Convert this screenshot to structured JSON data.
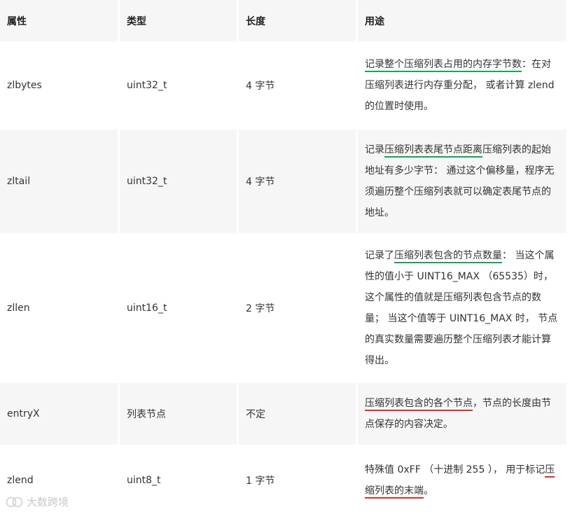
{
  "headers": [
    "属性",
    "类型",
    "长度",
    "用途"
  ],
  "rows": [
    {
      "attr": "zlbytes",
      "type": "uint32_t",
      "len": "4 字节",
      "desc": [
        {
          "t": "记录整个压缩列表占用的内存字节数",
          "u": "g"
        },
        {
          "t": "：在对压缩列表进行内存重分配， 或者计算 zlend 的位置时使用。"
        }
      ]
    },
    {
      "attr": "zltail",
      "type": "uint32_t",
      "len": "4 字节",
      "desc": [
        {
          "t": "记录"
        },
        {
          "t": "压缩列表表尾节点距离",
          "u": "g"
        },
        {
          "t": "压缩列表的起始地址有多少字节： 通过这个偏移量，程序无须遍历整个压缩列表就可以确定表尾节点的地址。"
        }
      ]
    },
    {
      "attr": "zllen",
      "type": "uint16_t",
      "len": "2 字节",
      "desc": [
        {
          "t": "记录了"
        },
        {
          "t": "压缩列表包含的节点数量",
          "u": "g"
        },
        {
          "t": "： 当这个属性的值小于 UINT16_MAX （65535）时， 这个属性的值就是压缩列表包含节点的数量； 当这个值等于 UINT16_MAX 时， 节点的真实数量需要遍历整个压缩列表才能计算得出。"
        }
      ]
    },
    {
      "attr": "entryX",
      "type": "列表节点",
      "len": "不定",
      "desc": [
        {
          "t": "压缩列表包含的各个节点",
          "u": "r"
        },
        {
          "t": "，节点的长度由节点保存的内容决定。"
        }
      ]
    },
    {
      "attr": "zlend",
      "type": "uint8_t",
      "len": "1 字节",
      "desc": [
        {
          "t": "特殊值 0xFF （十进制 255 ）， 用于标记"
        },
        {
          "t": "压缩列表的末端",
          "u": "r"
        },
        {
          "t": "。"
        }
      ]
    }
  ],
  "watermark": "大数跨境",
  "colors": {
    "underline_green": "#1aa35a",
    "underline_red": "#d9302c",
    "row_shade": "#f6f6f6"
  }
}
